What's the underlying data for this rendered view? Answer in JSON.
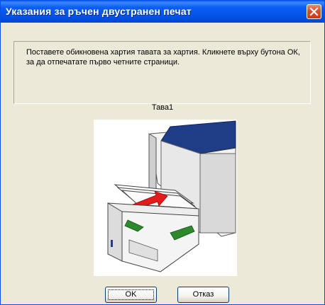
{
  "window": {
    "title": "Указания за ръчен двустранен печат"
  },
  "message": "Поставете обикновена хартия тавата за хартия. Кликнете върху бутона ОК, за да отпечатате първо четните страници.",
  "tray": {
    "label": "Тава1",
    "image": "printer-paper-tray-illustration"
  },
  "buttons": {
    "ok": "OK",
    "cancel": "Отказ"
  },
  "colors": {
    "title_bar": "#0553e6",
    "close_button": "#d6512c",
    "dialog_background": "#ece9d8"
  },
  "icons": {
    "close": "close-icon"
  }
}
